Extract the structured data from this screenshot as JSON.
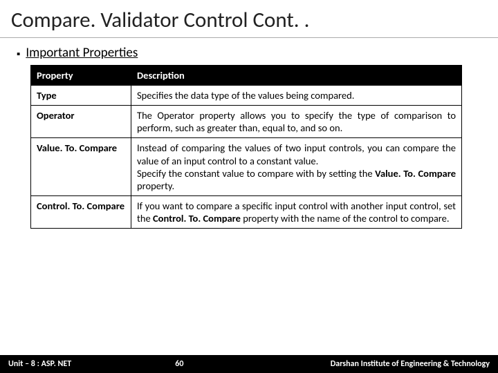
{
  "title": "Compare. Validator Control Cont. .",
  "section_heading": "Important Properties",
  "table": {
    "headers": [
      "Property",
      "Description"
    ],
    "rows": [
      {
        "property": "Type",
        "description": "Specifies the data type of the values being compared."
      },
      {
        "property": "Operator",
        "description": "The Operator property allows you to specify the type of comparison to perform, such as greater than, equal to, and so on."
      },
      {
        "property": "Value. To. Compare",
        "description_parts": [
          "Instead of comparing the values of two input controls, you can compare the value of an input control to a constant value.",
          "Specify the constant value to compare with by setting the ",
          "Value. To. Compare",
          " property."
        ]
      },
      {
        "property": "Control. To. Compare",
        "description_parts": [
          "If you want to compare a specific input control with another input control, set the ",
          "Control. To. Compare",
          " property with the name of the control to compare."
        ]
      }
    ]
  },
  "footer": {
    "left": "Unit – 8 : ASP. NET",
    "center": "60",
    "right": "Darshan Institute of Engineering & Technology"
  }
}
